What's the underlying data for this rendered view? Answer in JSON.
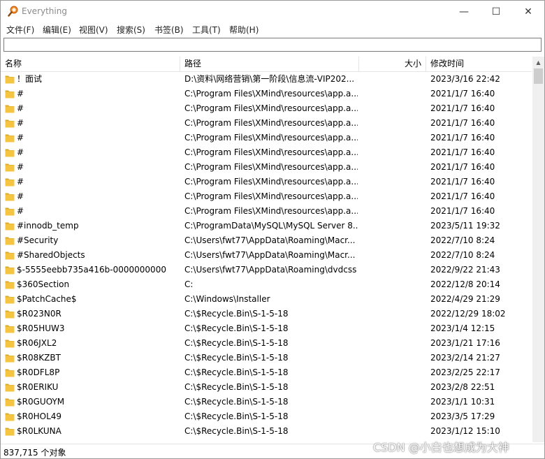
{
  "window": {
    "title": "Everything"
  },
  "window_controls": {
    "minimize": "—",
    "maximize": "☐",
    "close": "✕"
  },
  "menu": [
    "文件(F)",
    "编辑(E)",
    "视图(V)",
    "搜索(S)",
    "书签(B)",
    "工具(T)",
    "帮助(H)"
  ],
  "search": {
    "value": "",
    "placeholder": ""
  },
  "columns": {
    "name": "名称",
    "path": "路径",
    "size": "大小",
    "modified": "修改时间"
  },
  "rows": [
    {
      "name": "！面试",
      "path": "D:\\资料\\网络营销\\第一阶段\\信息流-VIP202...",
      "modified": "2023/3/16 22:42"
    },
    {
      "name": "#",
      "path": "C:\\Program Files\\XMind\\resources\\app.a...",
      "modified": "2021/1/7 16:40"
    },
    {
      "name": "#",
      "path": "C:\\Program Files\\XMind\\resources\\app.a...",
      "modified": "2021/1/7 16:40"
    },
    {
      "name": "#",
      "path": "C:\\Program Files\\XMind\\resources\\app.a...",
      "modified": "2021/1/7 16:40"
    },
    {
      "name": "#",
      "path": "C:\\Program Files\\XMind\\resources\\app.a...",
      "modified": "2021/1/7 16:40"
    },
    {
      "name": "#",
      "path": "C:\\Program Files\\XMind\\resources\\app.a...",
      "modified": "2021/1/7 16:40"
    },
    {
      "name": "#",
      "path": "C:\\Program Files\\XMind\\resources\\app.a...",
      "modified": "2021/1/7 16:40"
    },
    {
      "name": "#",
      "path": "C:\\Program Files\\XMind\\resources\\app.a...",
      "modified": "2021/1/7 16:40"
    },
    {
      "name": "#",
      "path": "C:\\Program Files\\XMind\\resources\\app.a...",
      "modified": "2021/1/7 16:40"
    },
    {
      "name": "#",
      "path": "C:\\Program Files\\XMind\\resources\\app.a...",
      "modified": "2021/1/7 16:40"
    },
    {
      "name": "#innodb_temp",
      "path": "C:\\ProgramData\\MySQL\\MySQL Server 8...",
      "modified": "2023/5/11 19:32"
    },
    {
      "name": "#Security",
      "path": "C:\\Users\\fwt77\\AppData\\Roaming\\Macr...",
      "modified": "2022/7/10 8:24"
    },
    {
      "name": "#SharedObjects",
      "path": "C:\\Users\\fwt77\\AppData\\Roaming\\Macr...",
      "modified": "2022/7/10 8:24"
    },
    {
      "name": "$-5555eebb735a416b-0000000000",
      "path": "C:\\Users\\fwt77\\AppData\\Roaming\\dvdcss",
      "modified": "2022/9/22 21:43"
    },
    {
      "name": "$360Section",
      "path": "C:",
      "modified": "2022/12/8 20:14"
    },
    {
      "name": "$PatchCache$",
      "path": "C:\\Windows\\Installer",
      "modified": "2022/4/29 21:29"
    },
    {
      "name": "$R023N0R",
      "path": "C:\\$Recycle.Bin\\S-1-5-18",
      "modified": "2022/12/29 18:02"
    },
    {
      "name": "$R05HUW3",
      "path": "C:\\$Recycle.Bin\\S-1-5-18",
      "modified": "2023/1/4 12:15"
    },
    {
      "name": "$R06JXL2",
      "path": "C:\\$Recycle.Bin\\S-1-5-18",
      "modified": "2023/1/21 17:16"
    },
    {
      "name": "$R08KZBT",
      "path": "C:\\$Recycle.Bin\\S-1-5-18",
      "modified": "2023/2/14 21:27"
    },
    {
      "name": "$R0DFL8P",
      "path": "C:\\$Recycle.Bin\\S-1-5-18",
      "modified": "2023/2/25 22:17"
    },
    {
      "name": "$R0ERIKU",
      "path": "C:\\$Recycle.Bin\\S-1-5-18",
      "modified": "2023/2/8 22:51"
    },
    {
      "name": "$R0GUOYM",
      "path": "C:\\$Recycle.Bin\\S-1-5-18",
      "modified": "2023/1/1 10:31"
    },
    {
      "name": "$R0HOL49",
      "path": "C:\\$Recycle.Bin\\S-1-5-18",
      "modified": "2023/3/5 17:29"
    },
    {
      "name": "$R0LKUNA",
      "path": "C:\\$Recycle.Bin\\S-1-5-18",
      "modified": "2023/1/12 15:10"
    }
  ],
  "status": {
    "count": "837,715 个对象"
  },
  "watermark": "CSDN @小白也想成为大神",
  "colors": {
    "folder": "#f5c542",
    "folder_edge": "#dcaa2a",
    "accent": "#f08a24"
  }
}
